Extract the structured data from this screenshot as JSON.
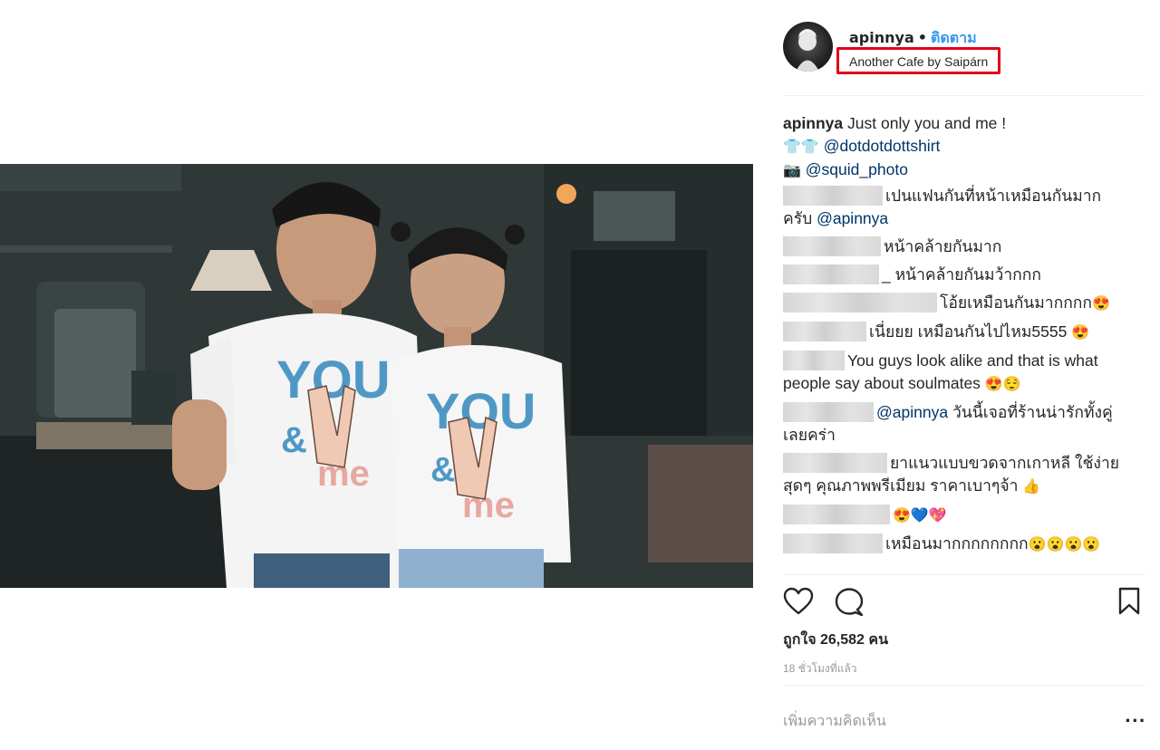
{
  "post": {
    "username": "apinnya",
    "separator": "•",
    "follow_label": "ติดตาม",
    "location": "Another Cafe by Saipárn",
    "caption_user": "apinnya",
    "caption_text": "Just only you and me !",
    "caption_line2_emoji": "👕👕",
    "caption_line2_mention": "@dotdotdottshirt",
    "caption_line3_emoji": "📷",
    "caption_line3_mention": "@squid_photo",
    "photo_shirt_text_you": "YOU",
    "photo_shirt_text_amp": "&",
    "photo_shirt_text_me": "me"
  },
  "comments": [
    {
      "text": "เปนแฟนกันที่หน้าเหมือนกันมาก ครับ ",
      "mention": "@apinnya",
      "emoji": ""
    },
    {
      "text": "หน้าคล้ายกันมาก",
      "mention": "",
      "emoji": ""
    },
    {
      "text": "_ หน้าคล้ายกันมว้ากกก",
      "mention": "",
      "emoji": ""
    },
    {
      "text": "โอ้ยเหมือนกันมากกกก",
      "mention": "",
      "emoji": "😍"
    },
    {
      "text": "เนี่ยยย เหมือนกันไปไหม5555 ",
      "mention": "",
      "emoji": "😍"
    },
    {
      "text": "You guys look alike and that is what people say about soulmates ",
      "mention": "",
      "emoji": "😍😌"
    },
    {
      "text": " วันนี้เจอที่ร้านน่ารักทั้งคู่เลยคร่า",
      "mention": "@apinnya",
      "emoji": ""
    },
    {
      "text": "ยาแนวแบบขวดจากเกาหลี ใช้ง่ายสุดๆ คุณภาพพรีเมียม ราคาเบาๆจ้า ",
      "mention": "",
      "emoji": "👍"
    },
    {
      "text": "",
      "mention": "",
      "emoji": "😍💙💖"
    },
    {
      "text": "เหมือนมากกกกกกกก",
      "mention": "",
      "emoji": "😮😮😮😮"
    }
  ],
  "footer": {
    "likes": "ถูกใจ 26,582 คน",
    "time": "18 ชั่วโมงที่แล้ว",
    "add_comment_placeholder": "เพิ่มความคิดเห็น",
    "more_label": "..."
  },
  "icons": {
    "like": "heart-icon",
    "comment": "comment-icon",
    "save": "bookmark-icon",
    "more": "more-options-icon"
  },
  "colors": {
    "link": "#3897f0",
    "mention": "#003569",
    "location_highlight": "#e2001a",
    "muted": "#999999"
  }
}
